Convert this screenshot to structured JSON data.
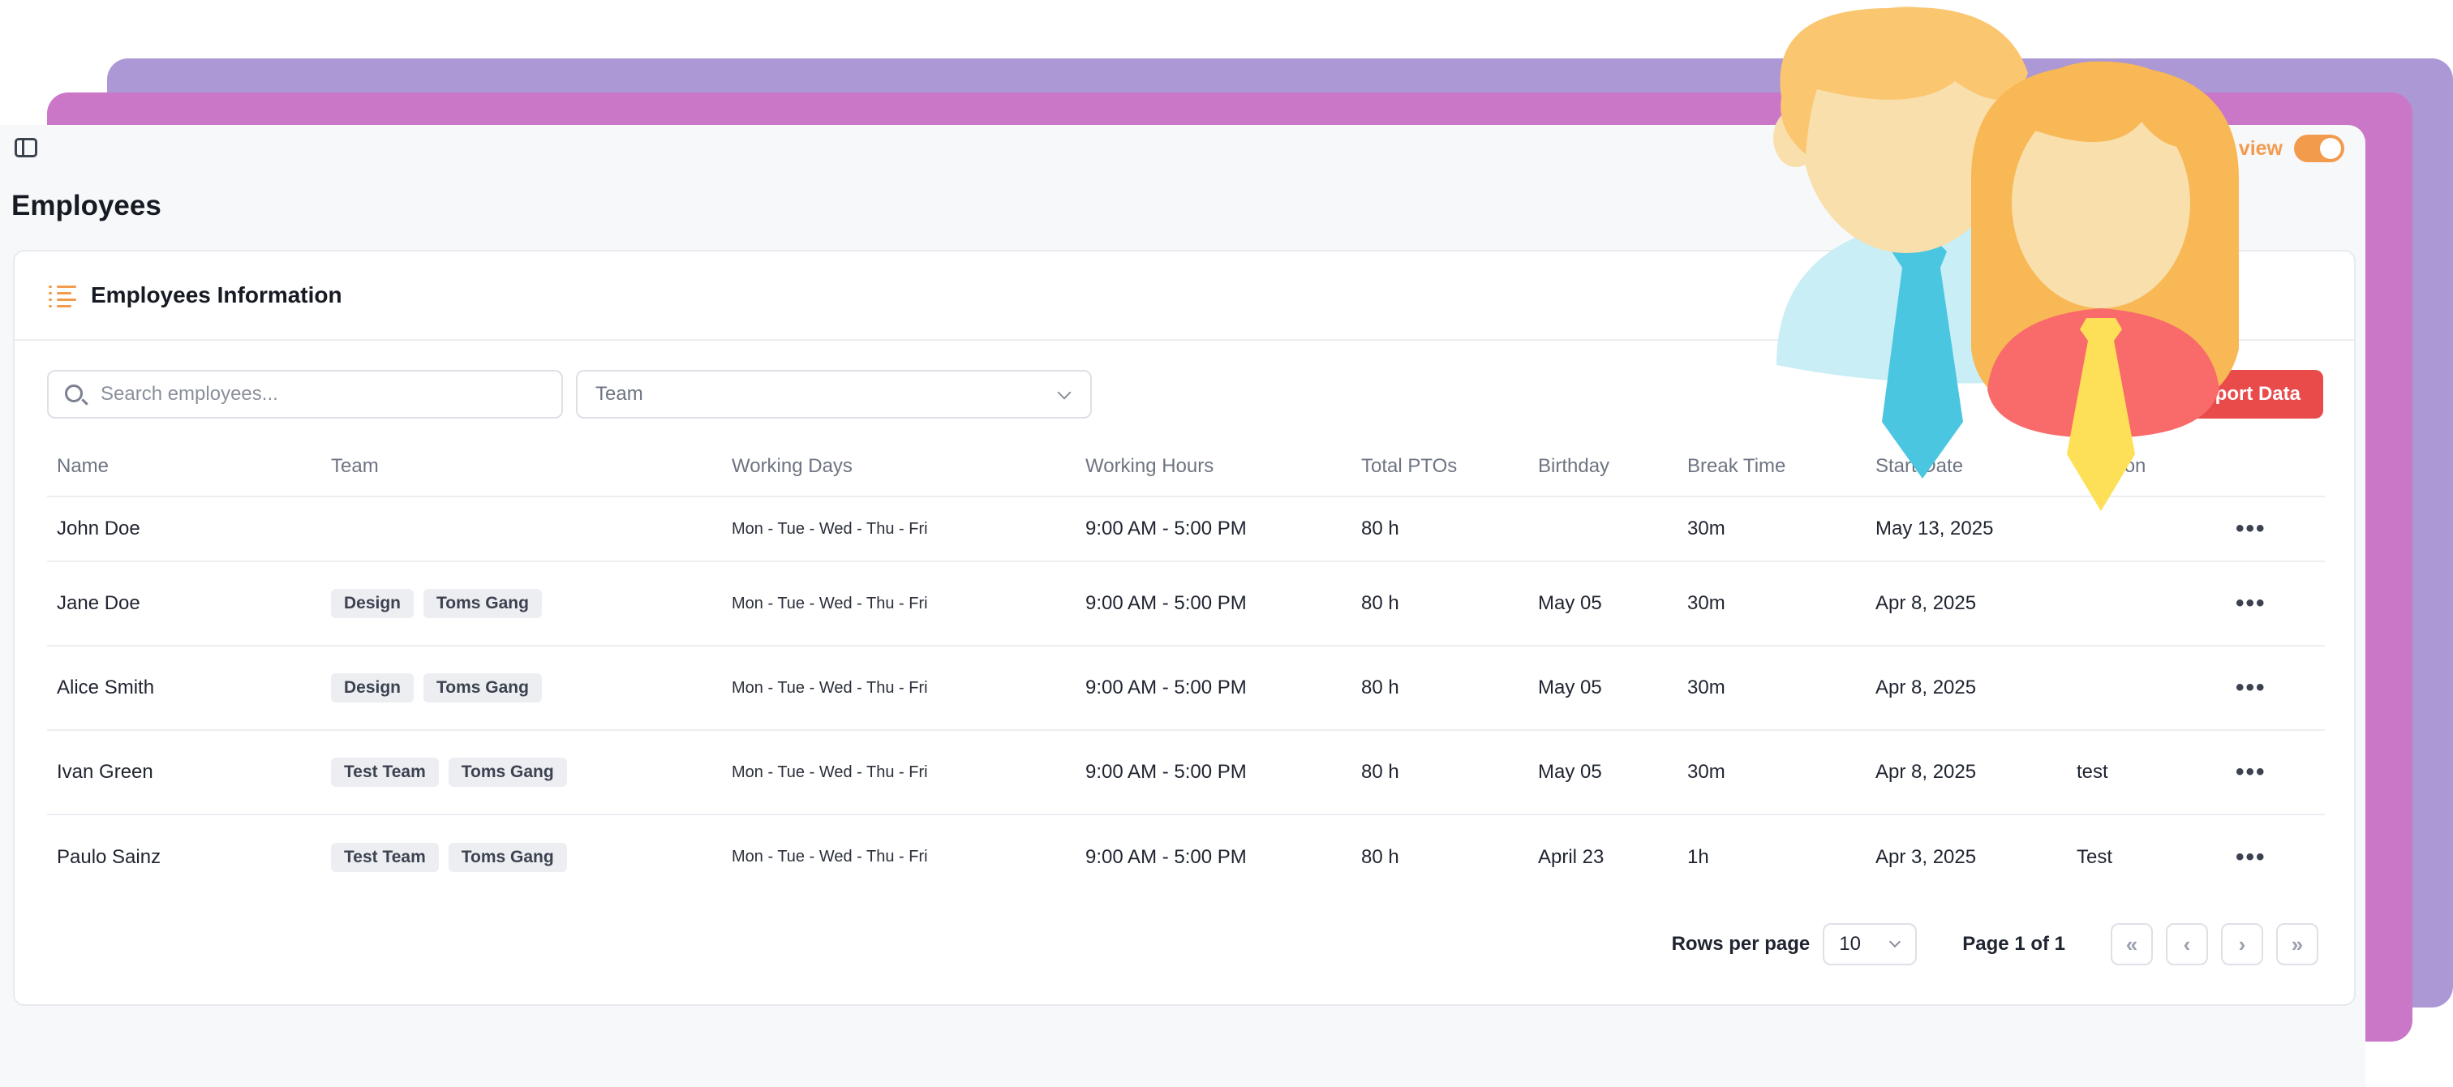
{
  "header": {
    "view_toggle_label": "view",
    "page_title": "Employees"
  },
  "panel": {
    "title": "Employees Information",
    "search_placeholder": "Search employees...",
    "team_filter": "Team",
    "export_label": "Export Data"
  },
  "table": {
    "columns": [
      "Name",
      "Team",
      "Working Days",
      "Working Hours",
      "Total PTOs",
      "Birthday",
      "Break Time",
      "Start Date",
      "Position",
      ""
    ],
    "rows": [
      {
        "name": "John Doe",
        "tags": [],
        "days": "Mon - Tue - Wed - Thu - Fri",
        "hours": "9:00 AM - 5:00 PM",
        "ptos": "80 h",
        "birthday": "",
        "break": "30m",
        "start": "May 13, 2025",
        "position": ""
      },
      {
        "name": "Jane Doe",
        "tags": [
          "Design",
          "Toms Gang"
        ],
        "days": "Mon - Tue - Wed - Thu - Fri",
        "hours": "9:00 AM - 5:00 PM",
        "ptos": "80 h",
        "birthday": "May 05",
        "break": "30m",
        "start": "Apr 8, 2025",
        "position": ""
      },
      {
        "name": "Alice Smith",
        "tags": [
          "Design",
          "Toms Gang"
        ],
        "days": "Mon - Tue - Wed - Thu - Fri",
        "hours": "9:00 AM - 5:00 PM",
        "ptos": "80 h",
        "birthday": "May 05",
        "break": "30m",
        "start": "Apr 8, 2025",
        "position": ""
      },
      {
        "name": "Ivan Green",
        "tags": [
          "Test Team",
          "Toms Gang"
        ],
        "days": "Mon - Tue - Wed - Thu - Fri",
        "hours": "9:00 AM - 5:00 PM",
        "ptos": "80 h",
        "birthday": "May 05",
        "break": "30m",
        "start": "Apr 8, 2025",
        "position": "test"
      },
      {
        "name": "Paulo Sainz",
        "tags": [
          "Test Team",
          "Toms Gang"
        ],
        "days": "Mon - Tue - Wed - Thu - Fri",
        "hours": "9:00 AM - 5:00 PM",
        "ptos": "80 h",
        "birthday": "April 23",
        "break": "1h",
        "start": "Apr 3, 2025",
        "position": "Test"
      }
    ],
    "row_menu_glyph": "•••"
  },
  "pagination": {
    "rows_per_page_label": "Rows per page",
    "rows_per_page_value": "10",
    "page_info": "Page 1 of 1",
    "first_glyph": "«",
    "prev_glyph": "‹",
    "next_glyph": "›",
    "last_glyph": "»"
  },
  "colors": {
    "accent_orange": "#f39b4d",
    "export_red": "#e94b4b",
    "back_card_purple": "#ab98d4",
    "back_card_magenta": "#cb77c8"
  }
}
